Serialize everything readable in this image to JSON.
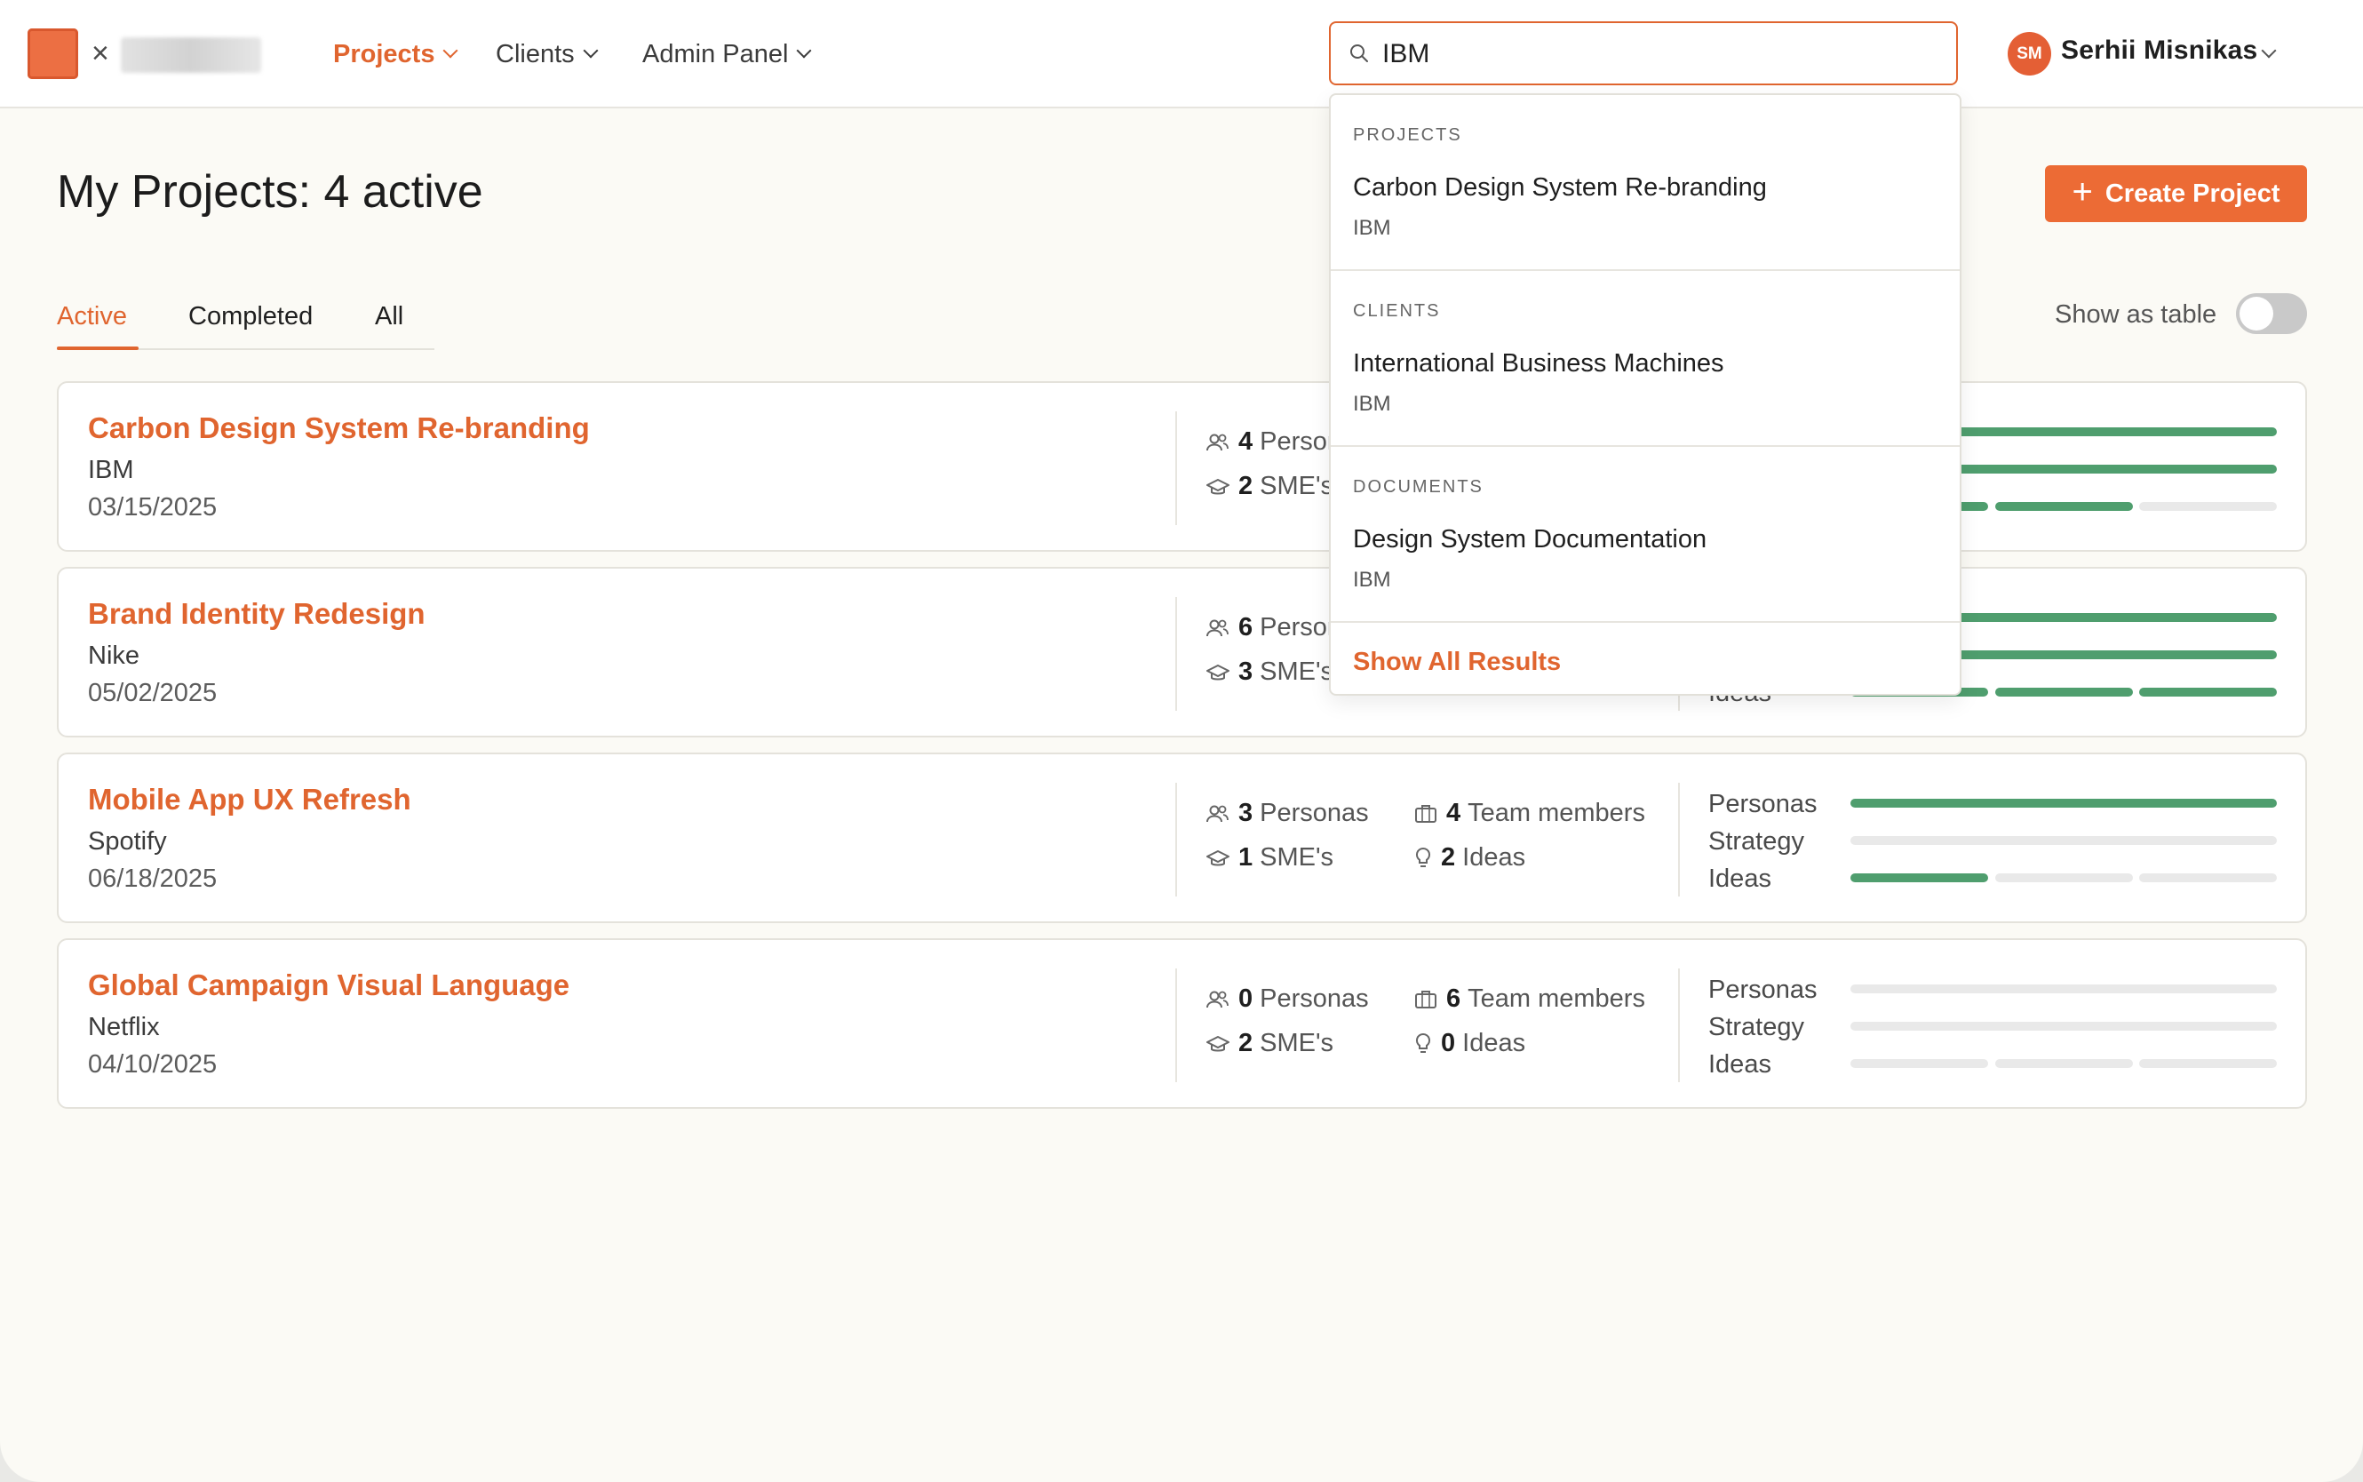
{
  "topbar": {
    "nav": [
      {
        "label": "Projects"
      },
      {
        "label": "Clients"
      },
      {
        "label": "Admin Panel"
      }
    ],
    "search": {
      "value": "IBM",
      "placeholder": ""
    },
    "user": {
      "initials": "SM",
      "name": "Serhii Misnikas"
    }
  },
  "header": {
    "title": "My Projects: 4 active",
    "create_label": "Create Project",
    "tabs": [
      {
        "label": "Active"
      },
      {
        "label": "Completed"
      },
      {
        "label": "All"
      }
    ],
    "toggle_label": "Show as table",
    "toggle_on": false
  },
  "labels": {
    "personas": "Personas",
    "smes": "SME's",
    "team": "Team members",
    "ideas": "Ideas",
    "progress_personas": "Personas",
    "progress_strategy": "Strategy",
    "progress_ideas": "Ideas"
  },
  "projects": [
    {
      "title": "Carbon Design System Re-branding",
      "client": "IBM",
      "date": "03/15/2025",
      "personas": "4",
      "smes": "2",
      "team": "",
      "ideas": "",
      "progress": {
        "personas": 1,
        "strategy": 1,
        "ideas_segments": [
          1,
          1,
          0
        ]
      }
    },
    {
      "title": "Brand Identity Redesign",
      "client": "Nike",
      "date": "05/02/2025",
      "personas": "6",
      "smes": "3",
      "team": "",
      "ideas": "",
      "progress": {
        "personas": 1,
        "strategy": 1,
        "ideas_segments": [
          1,
          1,
          1
        ]
      }
    },
    {
      "title": "Mobile App UX Refresh",
      "client": "Spotify",
      "date": "06/18/2025",
      "personas": "3",
      "smes": "1",
      "team": "4",
      "ideas": "2",
      "progress": {
        "personas": 1,
        "strategy": 0,
        "ideas_segments": [
          1,
          0,
          0
        ]
      }
    },
    {
      "title": "Global Campaign Visual Language",
      "client": "Netflix",
      "date": "04/10/2025",
      "personas": "0",
      "smes": "2",
      "team": "6",
      "ideas": "0",
      "progress": {
        "personas": 0,
        "strategy": 0,
        "ideas_segments": [
          0,
          0,
          0
        ]
      }
    }
  ],
  "dropdown": {
    "sections": [
      {
        "heading": "PROJECTS",
        "item_title": "Carbon Design System Re-branding",
        "item_sub": "IBM"
      },
      {
        "heading": "CLIENTS",
        "item_title": "International Business Machines",
        "item_sub": "IBM"
      },
      {
        "heading": "DOCUMENTS",
        "item_title": "Design System Documentation",
        "item_sub": "IBM"
      }
    ],
    "show_all": "Show All Results"
  },
  "colors": {
    "accent": "#e0652f",
    "progress": "#4f9e6e",
    "progress_empty": "#e9e9e9"
  }
}
